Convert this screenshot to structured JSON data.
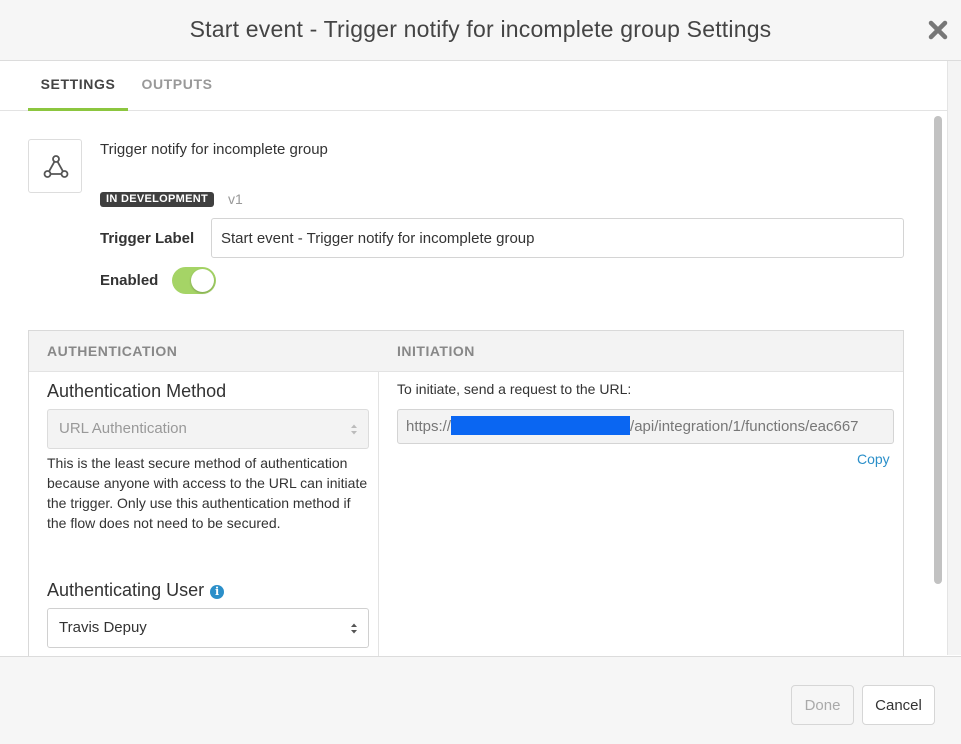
{
  "dialog": {
    "title": "Start event - Trigger notify for incomplete group Settings"
  },
  "tabs": [
    {
      "label": "SETTINGS",
      "active": true
    },
    {
      "label": "OUTPUTS",
      "active": false
    }
  ],
  "trigger": {
    "icon": "webhook-icon",
    "name": "Trigger notify for incomplete group",
    "status_badge": "IN DEVELOPMENT",
    "version": "v1",
    "label_field_label": "Trigger Label",
    "label_value": "Start event - Trigger notify for incomplete group",
    "enabled_label": "Enabled",
    "enabled": true
  },
  "authentication": {
    "header": "AUTHENTICATION",
    "method_title": "Authentication Method",
    "method_value": "URL Authentication",
    "method_description": "This is the least secure method of authentication because anyone with access to the URL can initiate the trigger. Only use this authentication method if the flow does not need to be secured.",
    "user_title": "Authenticating User",
    "user_value": "Travis Depuy"
  },
  "initiation": {
    "header": "INITIATION",
    "instruction": "To initiate, send a request to the URL:",
    "url_prefix": "https://",
    "url_suffix": "/api/integration/1/functions/eac667",
    "copy_label": "Copy"
  },
  "footer": {
    "done_label": "Done",
    "cancel_label": "Cancel"
  },
  "colors": {
    "accent_green": "#8cc63f",
    "toggle_on": "#a5d466",
    "link_blue": "#2b8fc9",
    "redaction": "#0a66f2"
  }
}
